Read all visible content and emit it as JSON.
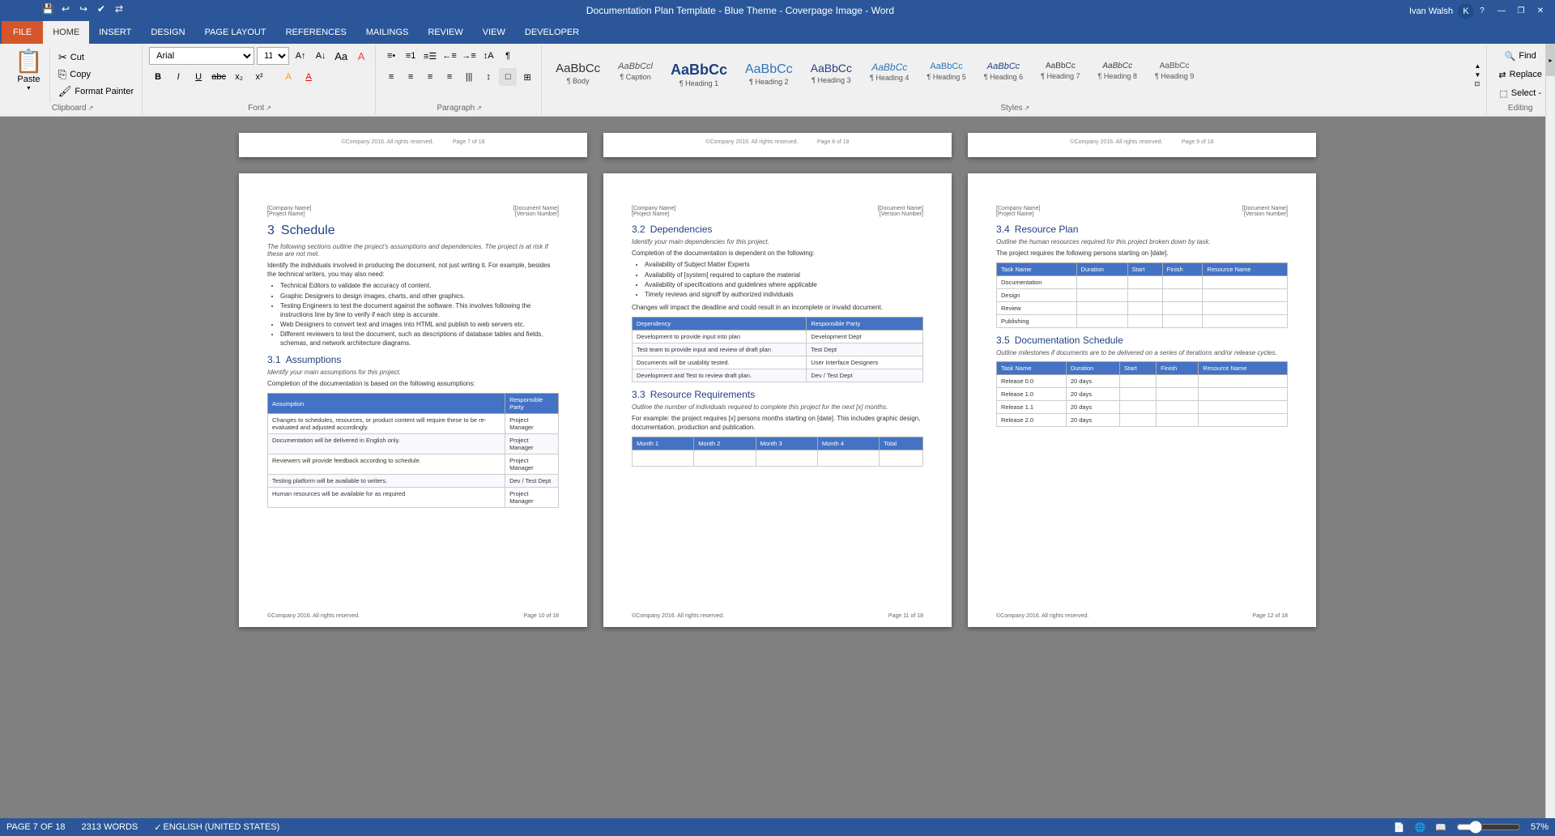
{
  "titleBar": {
    "title": "Documentation Plan Template - Blue Theme - Coverpage Image - Word",
    "controls": [
      "?",
      "—",
      "❐",
      "✕"
    ]
  },
  "quickAccess": {
    "buttons": [
      "💾",
      "↩",
      "↪",
      "✔",
      "⇄"
    ]
  },
  "ribbonTabs": {
    "items": [
      "FILE",
      "HOME",
      "INSERT",
      "DESIGN",
      "PAGE LAYOUT",
      "REFERENCES",
      "MAILINGS",
      "REVIEW",
      "VIEW",
      "DEVELOPER"
    ],
    "active": "HOME"
  },
  "ribbon": {
    "clipboard": {
      "label": "Clipboard",
      "paste": "Paste",
      "copy": "Copy",
      "cut": "Cut",
      "formatPainter": "Format Painter"
    },
    "font": {
      "label": "Font",
      "name": "Arial",
      "size": "11",
      "growBtn": "A↑",
      "shrinkBtn": "A↓",
      "clearBtn": "A",
      "bold": "B",
      "italic": "I",
      "underline": "U",
      "strikethrough": "abc",
      "subscript": "x₂",
      "superscript": "x²",
      "highlight": "A",
      "fontColor": "A"
    },
    "paragraph": {
      "label": "Paragraph",
      "bullets": "≡•",
      "numbering": "≡1",
      "multilevel": "≡☰",
      "decreaseIndent": "←≡",
      "increaseIndent": "→≡",
      "sort": "↕A",
      "showHide": "¶",
      "alignLeft": "≡",
      "center": "≡",
      "alignRight": "≡",
      "justify": "≡",
      "columns": "|||",
      "lineSpacing": "↕",
      "shading": "□",
      "borders": "⊞"
    },
    "styles": {
      "label": "Styles",
      "items": [
        {
          "label": "Body",
          "preview": "AaBbCc"
        },
        {
          "label": "Caption",
          "preview": "AaBbCcl"
        },
        {
          "label": "Heading 1",
          "preview": "AaBbCc"
        },
        {
          "label": "Heading 2",
          "preview": "AaBbCc"
        },
        {
          "label": "Heading 3",
          "preview": "AaBbCc"
        },
        {
          "label": "Heading 4",
          "preview": "AaBbCc"
        },
        {
          "label": "Heading 5",
          "preview": "AaBbCc"
        },
        {
          "label": "Heading 6",
          "preview": "AaBbCc"
        },
        {
          "label": "Heading 7",
          "preview": "AaBbCc"
        },
        {
          "label": "Heading 8",
          "preview": "AaBbCc"
        },
        {
          "label": "Heading 9",
          "preview": "AaBbCc"
        }
      ]
    },
    "editing": {
      "label": "Editing",
      "find": "Find",
      "replace": "Replace",
      "select": "Select -"
    }
  },
  "pages": {
    "leftPage": {
      "header": {
        "left": "[Company Name]",
        "leftSub": "[Project Name]",
        "right": "[Document Name]",
        "rightSub": "[Version Number]"
      },
      "sectionNum": "3",
      "sectionTitle": "Schedule",
      "intro": "The following sections outline the project's assumptions and dependencies. The project is at risk if these are not met.",
      "bodyText": "Identify the individuals involved in producing the document, not just writing it. For example, besides the technical writers, you may also need:",
      "bullets": [
        "Technical Editors to validate the accuracy of content.",
        "Graphic Designers to design images, charts, and other graphics.",
        "Testing Engineers to test the document against the software. This involves following the instructions line by line to verify if each step is accurate.",
        "Web Designers to convert text and images into HTML and publish to web servers etc.",
        "Different reviewers to test the document, such as descriptions of database tables and fields, schemas, and network architecture diagrams."
      ],
      "sub1Num": "3.1",
      "sub1Title": "Assumptions",
      "sub1Intro": "Identify your main assumptions for this project.",
      "sub1Body": "Completion of the documentation is based on the following assumptions:",
      "assumptionTable": {
        "headers": [
          "Assumption",
          "Responsible Party"
        ],
        "rows": [
          [
            "Changes to schedules, resources, or product content will require these to be re-evaluated and adjusted accordingly.",
            "Project Manager"
          ],
          [
            "Documentation will be delivered in English only.",
            "Project Manager"
          ],
          [
            "Reviewers will provide feedback according to schedule.",
            "Project Manager"
          ],
          [
            "Testing platform will be available to writers.",
            "Dev / Test Dept"
          ],
          [
            "Human resources will be available for as required",
            "Project Manager"
          ]
        ]
      },
      "footer": {
        "left": "©Company 2016. All rights reserved.",
        "right": "Page 10 of 18"
      }
    },
    "middlePage": {
      "header": {
        "left": "[Company Name]",
        "leftSub": "[Project Name]",
        "right": "[Document Name]",
        "rightSub": "[Version Number]"
      },
      "sub2Num": "3.2",
      "sub2Title": "Dependencies",
      "sub2Intro": "Identify your main dependencies for this project.",
      "sub2Body": "Completion of the documentation is dependent on the following:",
      "depBullets": [
        "Availability of Subject Matter Experts",
        "Availability of [system] required to capture the material",
        "Availability of specifications and guidelines where applicable",
        "Timely reviews and signoff by authorized individuals"
      ],
      "depNote": "Changes will impact the deadline and could result in an incomplete or invalid document.",
      "depTable": {
        "headers": [
          "Dependency",
          "Responsible Party"
        ],
        "rows": [
          [
            "Development to provide input into plan",
            "Development Dept"
          ],
          [
            "Test team to provide input and review of draft plan",
            "Test Dept"
          ],
          [
            "Documents will be usability tested.",
            "User Interface Designers"
          ],
          [
            "Development and Test to review draft plan.",
            "Dev / Test Dept"
          ]
        ]
      },
      "sub3Num": "3.3",
      "sub3Title": "Resource Requirements",
      "sub3Intro": "Outline the number of individuals required to complete this project for the next [x] months.",
      "sub3Body": "For example: the project requires [x] persons months starting on [date]. This includes graphic design, documentation, production and publication.",
      "resTable": {
        "headers": [
          "Month 1",
          "Month 2",
          "Month 3",
          "Month 4",
          "Total"
        ],
        "rows": [
          []
        ]
      },
      "footer": {
        "left": "©Company 2016. All rights reserved.",
        "right": "Page 11 of 18"
      }
    },
    "rightPage": {
      "header": {
        "left": "[Company Name]",
        "leftSub": "[Project Name]",
        "right": "[Document Name]",
        "rightSub": "[Version Number]"
      },
      "sub4Num": "3.4",
      "sub4Title": "Resource Plan",
      "sub4Intro": "Outline the human resources required for this project broken down by task.",
      "sub4Body": "The project requires the following persons starting on [date].",
      "resTable": {
        "headers": [
          "Task Name",
          "Duration",
          "Start",
          "Finish",
          "Resource Name"
        ],
        "rows": [
          [
            "Documentation",
            "",
            "",
            "",
            ""
          ],
          [
            "Design",
            "",
            "",
            "",
            ""
          ],
          [
            "Review",
            "",
            "",
            "",
            ""
          ],
          [
            "Publishing",
            "",
            "",
            "",
            ""
          ]
        ]
      },
      "sub5Num": "3.5",
      "sub5Title": "Documentation Schedule",
      "sub5Intro": "Outline milestones if documents are to be delivered on a series of iterations and/or release cycles.",
      "docSchedTable": {
        "headers": [
          "Task Name",
          "Duration",
          "Start",
          "Finish",
          "Resource Name"
        ],
        "rows": [
          [
            "Release 0.0",
            "20 days",
            "",
            "",
            ""
          ],
          [
            "Release 1.0",
            "20 days",
            "",
            "",
            ""
          ],
          [
            "Release 1.1",
            "20 days",
            "",
            "",
            ""
          ],
          [
            "Release 2.0",
            "20 days",
            "",
            "",
            ""
          ]
        ]
      },
      "footer": {
        "left": "©Company 2016. All rights reserved.",
        "right": "Page 12 of 18"
      }
    }
  },
  "statusBar": {
    "page": "PAGE 7 OF 18",
    "words": "2313 WORDS",
    "lang": "ENGLISH (UNITED STATES)",
    "zoom": "57%"
  }
}
